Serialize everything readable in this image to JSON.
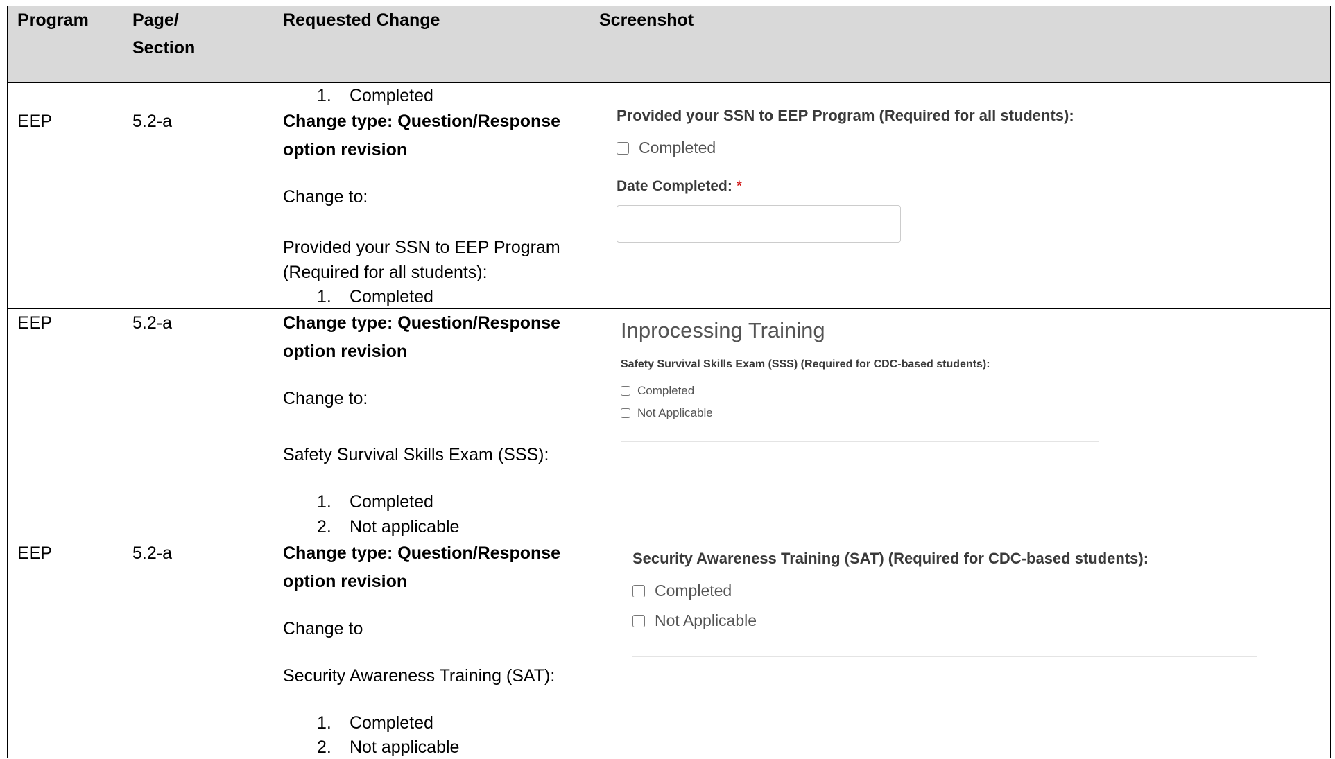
{
  "table": {
    "headers": {
      "program": "Program",
      "page_line1": "Page/",
      "page_line2": "Section",
      "requested": "Requested Change",
      "screenshot": "Screenshot"
    },
    "carryover": {
      "item_num": "1.",
      "item_text": "Completed"
    },
    "rows": [
      {
        "program": "EEP",
        "page": "5.2-a",
        "change_type_line1": "Change type: Question/Response",
        "change_type_line2": "option revision",
        "change_to": "Change to:",
        "question_line1": "Provided your SSN to EEP Program",
        "question_line2": "(Required for all students):",
        "items": [
          {
            "num": "1.",
            "text": "Completed"
          }
        ],
        "shot": {
          "question": "Provided your SSN to EEP Program (Required for all students):",
          "options": [
            "Completed"
          ],
          "date_label": "Date Completed:",
          "required_mark": "*"
        }
      },
      {
        "program": "EEP",
        "page": "5.2-a",
        "change_type_line1": "Change type: Question/Response",
        "change_type_line2": "option revision",
        "change_to": "Change to:",
        "question_line1": "Safety Survival Skills Exam (SSS):",
        "items": [
          {
            "num": "1.",
            "text": "Completed"
          },
          {
            "num": "2.",
            "text": "Not applicable"
          }
        ],
        "shot": {
          "section_title": "Inprocessing Training",
          "question": "Safety Survival Skills Exam (SSS) (Required for CDC-based students):",
          "options": [
            "Completed",
            "Not Applicable"
          ]
        }
      },
      {
        "program": "EEP",
        "page": "5.2-a",
        "change_type_line1": "Change type: Question/Response",
        "change_type_line2": "option revision",
        "change_to": "Change to",
        "question_line1": "Security Awareness Training (SAT):",
        "items": [
          {
            "num": "1.",
            "text": "Completed"
          },
          {
            "num": "2.",
            "text": "Not applicable"
          }
        ],
        "shot": {
          "question": "Security Awareness Training (SAT) (Required for CDC-based students):",
          "options": [
            "Completed",
            "Not Applicable"
          ]
        }
      }
    ]
  }
}
